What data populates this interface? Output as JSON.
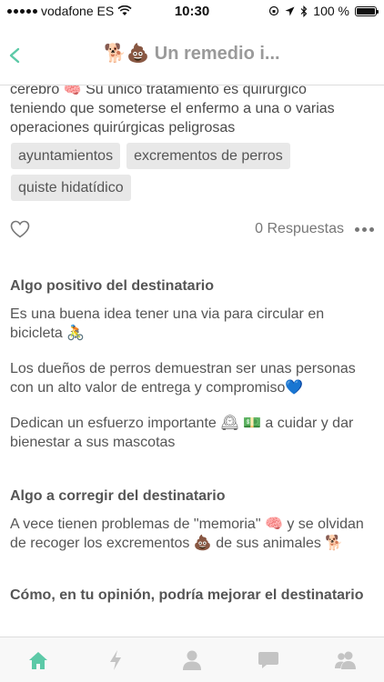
{
  "status": {
    "carrier": "vodafone ES",
    "time": "10:30",
    "battery": "100 %",
    "battery_level": 1.0
  },
  "nav": {
    "title": "🐕💩 Un remedio i..."
  },
  "post": {
    "intro_line1": "cerebro 🧠 Su único tratamiento es quirúrgico",
    "intro_line2": "teniendo que someterse el enfermo a una o varias",
    "intro_line3": "operaciones quirúrgicas peligrosas",
    "tags": [
      "ayuntamientos",
      "excrementos de perros",
      "quiste hidatídico"
    ],
    "responses": "0 Respuestas"
  },
  "positive": {
    "heading": "Algo positivo del destinatario",
    "p1": "Es una buena idea tener una via para circular en bicicleta 🚴",
    "p2": "Los dueños de perros demuestran ser unas personas con un alto valor de entrega y compromiso💙",
    "p3": "Dedican un esfuerzo importante 🕰 💵 a cuidar y dar bienestar a sus mascotas"
  },
  "correct": {
    "heading": "Algo a corregir del destinatario",
    "p1": "A vece tienen problemas de \"memoria\" 🧠 y se olvidan de recoger los excrementos 💩 de sus animales 🐕"
  },
  "improve": {
    "heading": "Cómo, en tu opinión, podría mejorar el destinatario"
  },
  "colors": {
    "accent": "#5cc9a7",
    "tab_inactive": "#c4c4c4"
  },
  "icons": [
    "back-chevron-icon",
    "heart-icon",
    "more-dots-icon",
    "home-icon",
    "lightning-icon",
    "person-icon",
    "chat-bubble-icon",
    "group-icon"
  ]
}
